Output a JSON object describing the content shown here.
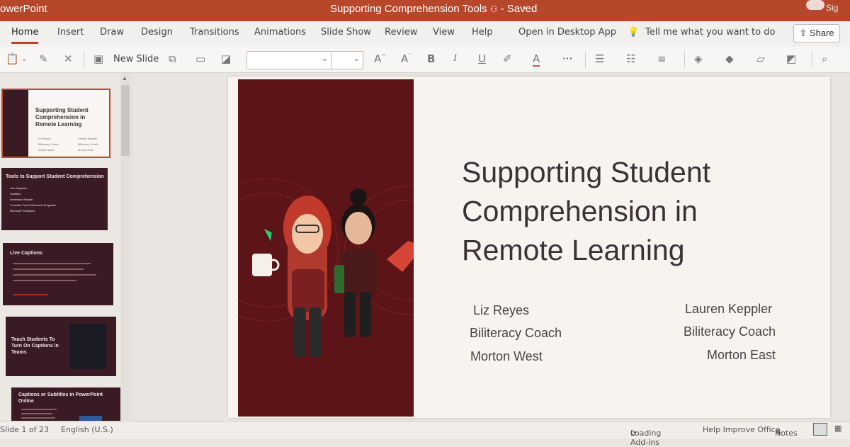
{
  "titlebar": {
    "app_name": "owerPoint",
    "document": "Supporting Comprehension Tools",
    "status": "- Saved",
    "signin": "Sig"
  },
  "tabs": [
    "Home",
    "Insert",
    "Draw",
    "Design",
    "Transitions",
    "Animations",
    "Slide Show",
    "Review",
    "View",
    "Help",
    "Open in Desktop App"
  ],
  "tell_me": "Tell me what you want to do",
  "share_label": "Share",
  "ribbon": {
    "new_slide": "New Slide",
    "font_name": "",
    "font_size": "",
    "bold": "B",
    "italic": "I",
    "underline": "U",
    "more": "···"
  },
  "thumbnails": [
    {
      "title": "Supporting Student Comprehension in Remote Learning",
      "lines": [
        "Liz Reyes",
        "Biliteracy Coach",
        "Morton West",
        "Lauren Keppler",
        "Biliteracy Coach",
        "Morton East"
      ]
    },
    {
      "title": "Tools to Support Student Comprehension",
      "lines": [
        "Live Captions",
        "Subtitles",
        "Immersive Reader",
        "Translate Text in Microsoft Programs",
        "Microsoft Translator"
      ]
    },
    {
      "title": "Live Captions",
      "lines": []
    },
    {
      "title": "Teach Students To Turn On Captions in Teams",
      "lines": []
    },
    {
      "title": "Captions or Subtitles in PowerPoint Online",
      "lines": []
    }
  ],
  "slide": {
    "title": "Supporting Student Comprehension in Remote Learning",
    "left_name": "Liz Reyes",
    "left_role": "Biliteracy Coach",
    "left_school": "Morton West",
    "right_name": "Lauren Keppler",
    "right_role": "Biliteracy Coach",
    "right_school": "Morton East"
  },
  "status": {
    "slide_counter": "Slide 1 of 23",
    "language": "English (U.S.)",
    "loading": "Loading Add-ins",
    "help": "Help Improve Office",
    "notes": "Notes"
  },
  "colors": {
    "brand": "#b7472a",
    "slide_panel": "#5c1418",
    "thumb_bg": "#3a1a24"
  }
}
